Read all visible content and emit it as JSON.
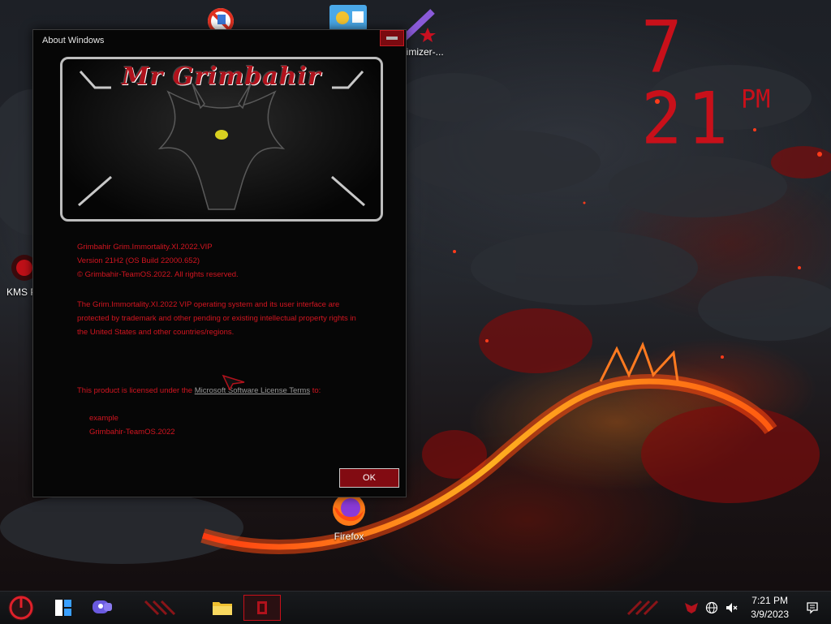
{
  "desktop": {
    "icons": [
      {
        "label": "Optimizer-..."
      },
      {
        "label": "KMS Porta"
      },
      {
        "label": "Firefox"
      }
    ],
    "clock_widget": {
      "time": "7 21",
      "ampm": "PM"
    }
  },
  "dialog": {
    "title": "About Windows",
    "logo_text": "Mr Grimbahir",
    "product_name": "Grimbahir Grim.Immortality.XI.2022.VIP",
    "version": "Version 21H2 (OS Build 22000.652)",
    "copyright": "© Grimbahir-TeamOS.2022. All rights reserved.",
    "description": "The Grim.Immortality.XI.2022 VIP operating system and its user interface are protected by trademark and other pending or existing intellectual property rights in the United States and other countries/regions.",
    "license_prefix": "This product is licensed under the ",
    "license_link": "Microsoft Software License Terms",
    "license_suffix": " to:",
    "licensee_1": "example",
    "licensee_2": "Grimbahir-TeamOS.2022",
    "ok_label": "OK"
  },
  "taskbar": {
    "time": "7:21 PM",
    "date": "3/9/2023",
    "accent": "#c8101a"
  }
}
